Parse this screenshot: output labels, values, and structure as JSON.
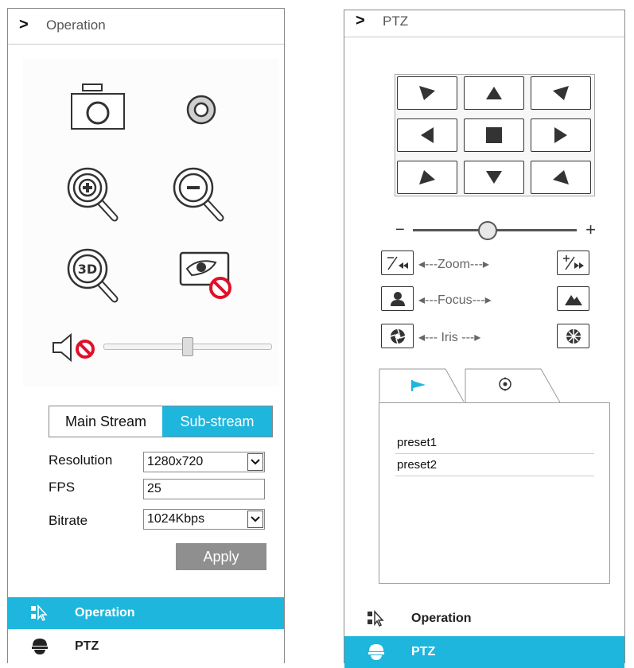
{
  "left_panel": {
    "title": "Operation",
    "stream_tabs": [
      "Main Stream",
      "Sub-stream"
    ],
    "active_stream_tab": "Sub-stream",
    "volume_level": 0.5,
    "form": {
      "resolution_label": "Resolution",
      "resolution_value": "1280x720",
      "fps_label": "FPS",
      "fps_value": "25",
      "bitrate_label": "Bitrate",
      "bitrate_value": "1024Kbps"
    },
    "apply_label": "Apply",
    "nav": [
      {
        "label": "Operation",
        "icon": "operation-icon",
        "active": true
      },
      {
        "label": "PTZ",
        "icon": "ptz-dome-icon",
        "active": false
      }
    ]
  },
  "right_panel": {
    "title": "PTZ",
    "speed_minus": "−",
    "speed_plus": "+",
    "speed_level": 0.45,
    "zoom_label": "◂---Zoom---▸",
    "focus_label": "◂---Focus---▸",
    "iris_label": "◂--- Iris ---▸",
    "presets": [
      "preset1",
      "preset2"
    ],
    "nav": [
      {
        "label": "Operation",
        "icon": "operation-icon",
        "active": false
      },
      {
        "label": "PTZ",
        "icon": "ptz-dome-icon",
        "active": true
      }
    ]
  },
  "colors": {
    "accent": "#1eb6dc",
    "apply_bg": "#8f8f8f",
    "mute_red": "#e0102a"
  }
}
